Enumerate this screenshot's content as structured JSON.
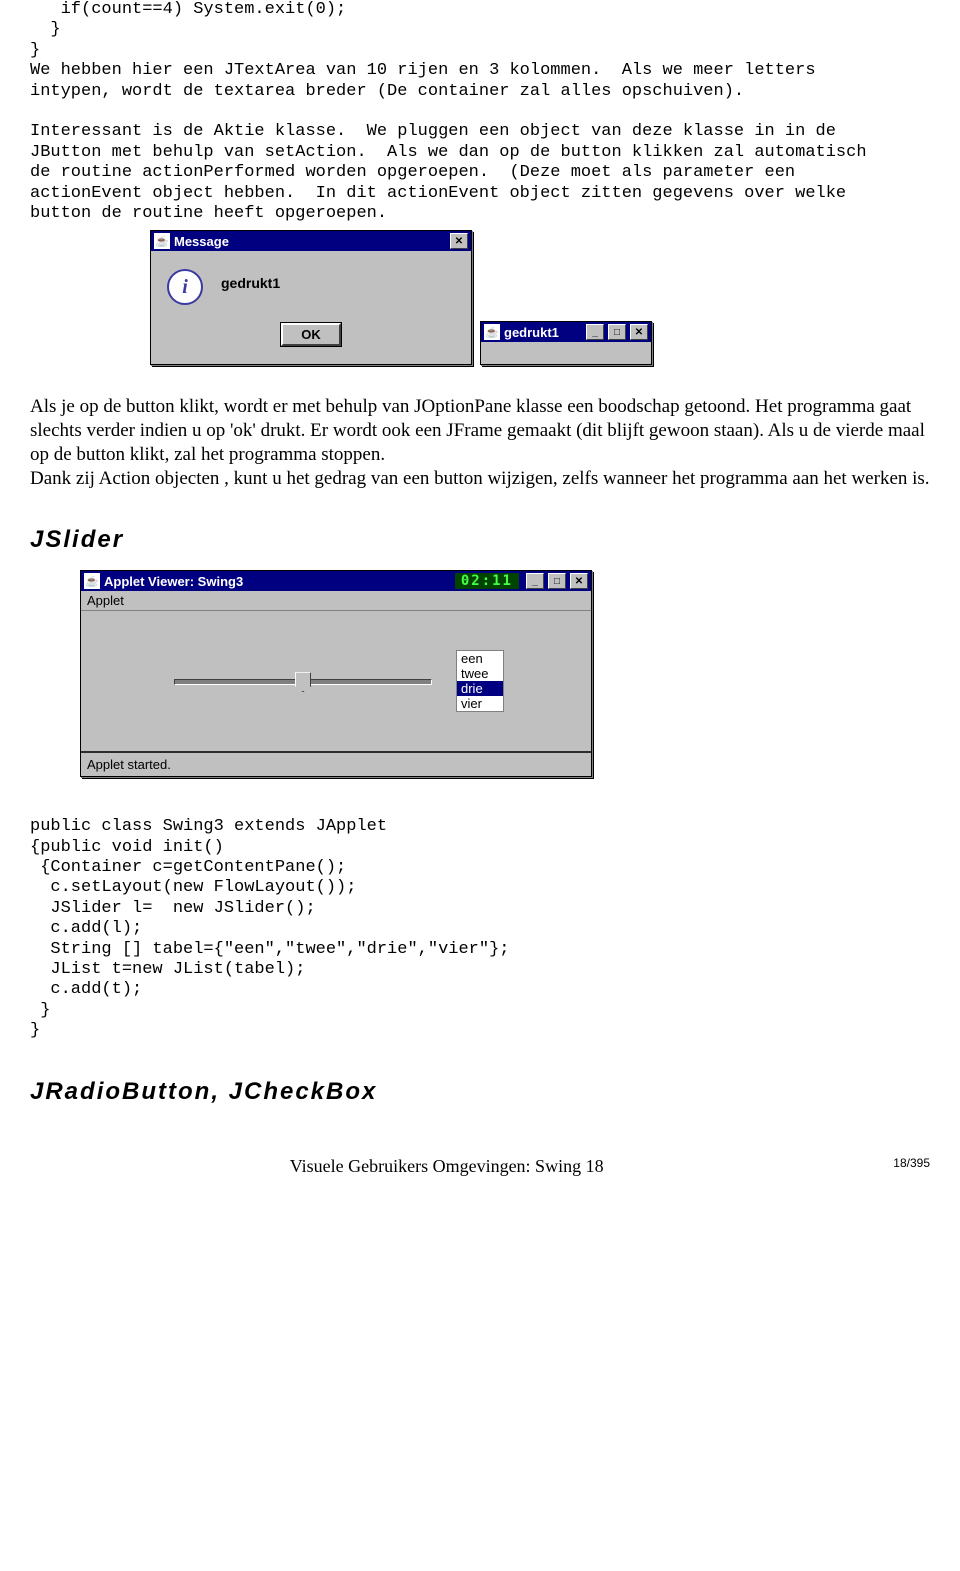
{
  "code1": "   if(count==4) System.exit(0);\n  }\n}\nWe hebben hier een JTextArea van 10 rijen en 3 kolommen.  Als we meer letters\nintypen, wordt de textarea breder (De container zal alles opschuiven).\n\nInteressant is de Aktie klasse.  We pluggen een object van deze klasse in in de\nJButton met behulp van setAction.  Als we dan op de button klikken zal automatisch\nde routine actionPerformed worden opgeroepen.  (Deze moet als parameter een\nactionEvent object hebben.  In dit actionEvent object zitten gegevens over welke\nbutton de routine heeft opgeroepen.",
  "msg": {
    "title": "Message",
    "text": "gedrukt1",
    "ok": "OK"
  },
  "smallwin": {
    "title": "gedrukt1"
  },
  "para1": "Als je op de button klikt, wordt er met behulp van JOptionPane klasse een boodschap getoond.  Het programma gaat slechts verder indien u op 'ok' drukt.   Er wordt ook een JFrame gemaakt (dit blijft gewoon staan).   Als u de vierde maal op de button klikt, zal het programma stoppen.",
  "para2": "Dank zij Action objecten , kunt u het gedrag van een button wijzigen, zelfs wanneer het programma aan het werken is.",
  "h_jslider": "JSlider",
  "applet": {
    "title": "Applet Viewer: Swing3",
    "clock": "02:11",
    "menu": "Applet",
    "list": [
      "een",
      "twee",
      "drie",
      "vier"
    ],
    "selected": "drie",
    "status": "Applet started."
  },
  "code2": "public class Swing3 extends JApplet\n{public void init()\n {Container c=getContentPane();\n  c.setLayout(new FlowLayout());\n  JSlider l=  new JSlider();\n  c.add(l);\n  String [] tabel={\"een\",\"twee\",\"drie\",\"vier\"};\n  JList t=new JList(tabel);\n  c.add(t);\n }\n}",
  "h_radio": "JRadioButton, JCheckBox",
  "footer": "Visuele Gebruikers Omgevingen: Swing 18",
  "pagenum": "18/395"
}
